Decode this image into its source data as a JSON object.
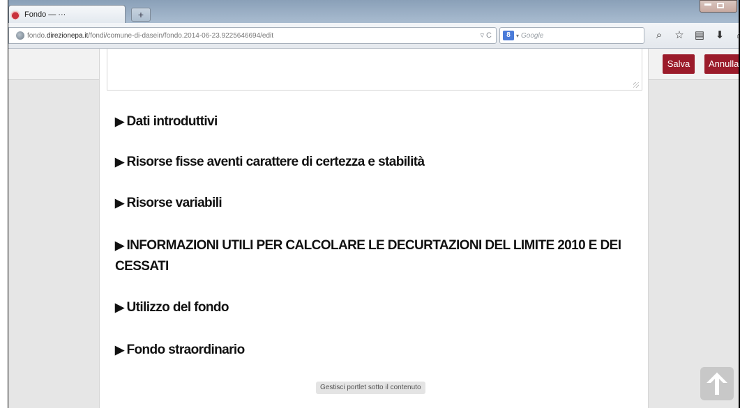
{
  "browser": {
    "tab_title": "Fondo — ···",
    "new_tab": "+",
    "url_prefix": "fondo.",
    "url_domain": "direzionepa.it",
    "url_path": "/fondi/comune-di-dasein/fondo.2014-06-23.9225646694/edit",
    "url_tools": "▿ C",
    "search_engine": "8",
    "search_placeholder": "Google"
  },
  "toolbar": {
    "save_label": "Salva",
    "cancel_label": "Annulla"
  },
  "sections": [
    {
      "label": "Dati introduttivi"
    },
    {
      "label": "Risorse fisse aventi carattere di certezza e stabilità"
    },
    {
      "label": "Risorse variabili"
    },
    {
      "label": "INFORMAZIONI UTILI PER CALCOLARE LE DECURTAZIONI DEL LIMITE 2010 E DEI CESSATI"
    },
    {
      "label": "Utilizzo del fondo"
    },
    {
      "label": "Fondo straordinario"
    }
  ],
  "portlet_link": "Gestisci portlet sotto il contenuto",
  "colors": {
    "accent_button": "#9b1b2a",
    "background": "#e6e6e6"
  },
  "icons": [
    "search-icon",
    "bookmark-star-icon",
    "reading-list-icon",
    "download-icon",
    "home-icon",
    "skype-icon",
    "scroll-top-arrow-icon"
  ]
}
